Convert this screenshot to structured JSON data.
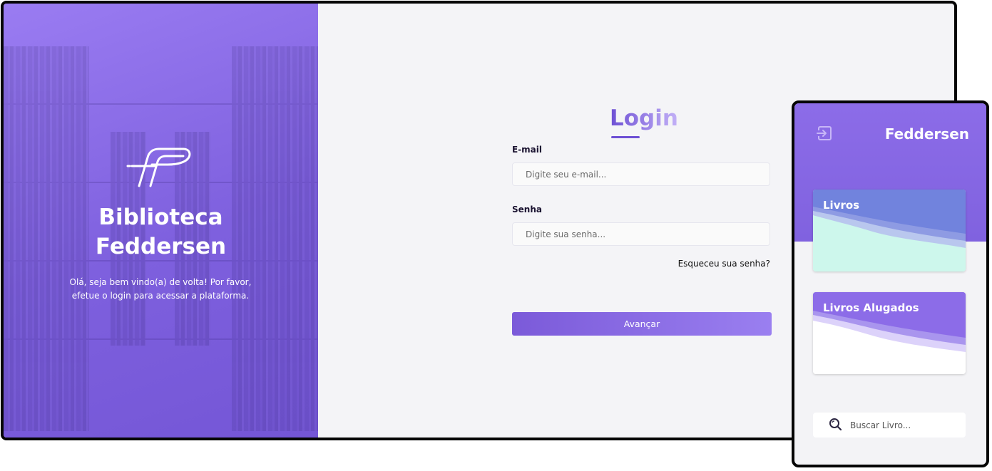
{
  "hero": {
    "title_line1": "Biblioteca",
    "title_line2": "Feddersen",
    "text_line1": "Olá, seja bem vindo(a) de volta! Por favor,",
    "text_line2": "efetue o login para acessar a plataforma.",
    "logo": "feddersen-f-logo"
  },
  "login": {
    "title": "Login",
    "email_label": "E-mail",
    "email_placeholder": "Digite seu e-mail...",
    "password_label": "Senha",
    "password_placeholder": "Digite sua senha...",
    "forgot": "Esqueceu sua senha?",
    "submit": "Avançar"
  },
  "mobile": {
    "brand": "Feddersen",
    "exit_icon": "exit-icon",
    "cards": [
      {
        "label": "Livros",
        "colors": {
          "top": "#7183dd",
          "bottom": "#cdf7ec"
        }
      },
      {
        "label": "Livros Alugados",
        "colors": {
          "top": "#8c6ce8",
          "bottom": "#ffffff"
        }
      }
    ],
    "search_placeholder": "Buscar Livro...",
    "search_icon": "search-icon"
  },
  "colors": {
    "accent": "#7b5ad9",
    "hero": "#8466e3",
    "frame": "#050505"
  }
}
